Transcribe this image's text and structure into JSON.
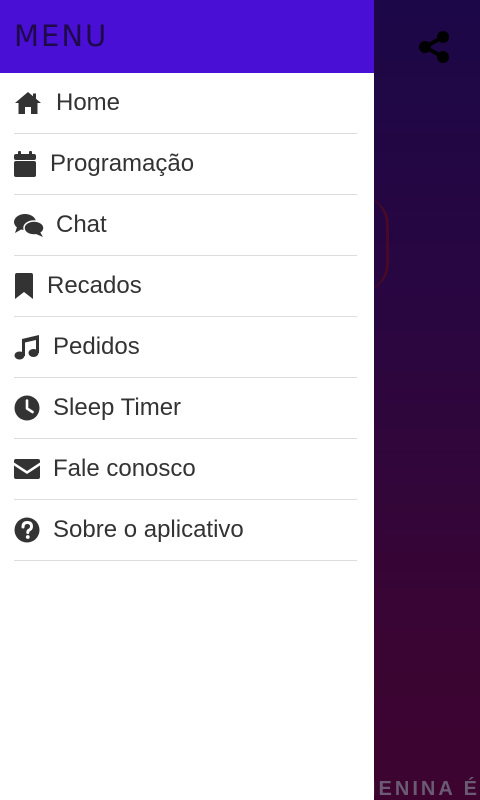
{
  "drawer": {
    "title": "MENU",
    "items": [
      {
        "label": "Home",
        "icon": "home-icon"
      },
      {
        "label": "Programação",
        "icon": "calendar-icon"
      },
      {
        "label": "Chat",
        "icon": "chat-bubbles-icon"
      },
      {
        "label": "Recados",
        "icon": "bookmark-icon"
      },
      {
        "label": "Pedidos",
        "icon": "music-note-icon"
      },
      {
        "label": "Sleep Timer",
        "icon": "clock-icon"
      },
      {
        "label": "Fale conosco",
        "icon": "envelope-icon"
      },
      {
        "label": "Sobre o aplicativo",
        "icon": "question-circle-icon"
      }
    ]
  },
  "background": {
    "share_icon": "share-icon",
    "footer_text": "IENINA É"
  },
  "colors": {
    "header": "#4a0fd4",
    "menu_text": "#333333",
    "icon": "#333333",
    "divider": "#dddddd",
    "background_top": "#1c0748",
    "background_bottom": "#3d0430"
  }
}
